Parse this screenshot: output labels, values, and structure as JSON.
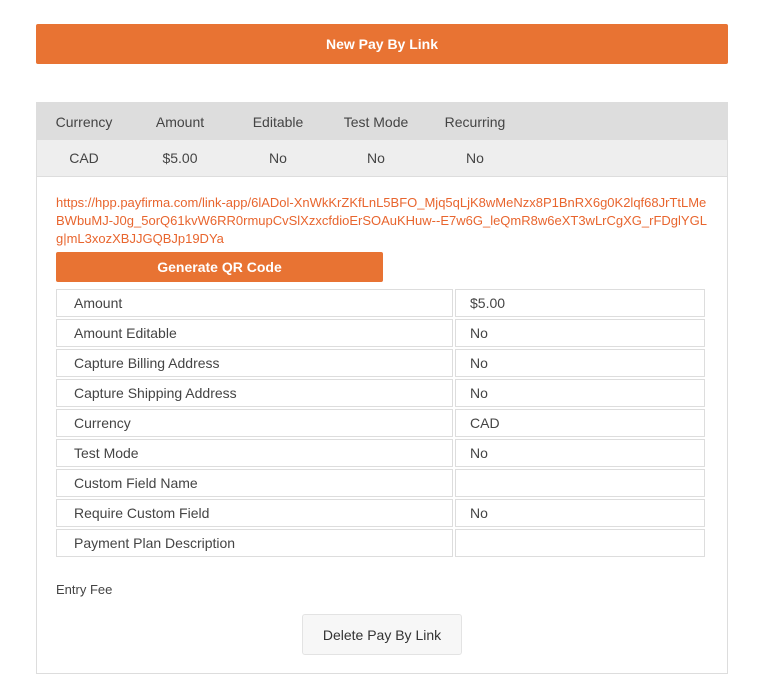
{
  "header": {
    "new_button_label": "New Pay By Link"
  },
  "colors": {
    "accent": "#e87333",
    "link": "#e8652e",
    "header_bg": "#dddddd",
    "row_bg": "#eeeeee"
  },
  "summary": {
    "columns": [
      "Currency",
      "Amount",
      "Editable",
      "Test Mode",
      "Recurring"
    ],
    "row": [
      "CAD",
      "$5.00",
      "No",
      "No",
      "No"
    ]
  },
  "link": {
    "url": "https://hpp.payfirma.com/link-app/6lADol-XnWkKrZKfLnL5BFO_Mjq5qLjK8wMeNzx8P1BnRX6g0K2lqf68JrTtLMeBWbuMJ-J0g_5orQ61kvW6RR0rmupCvSlXzxcfdioErSOAuKHuw--E7w6G_leQmR8w6eXT3wLrCgXG_rFDglYGLg|mL3xozXBJJGQBJp19DYa",
    "qr_button_label": "Generate QR Code"
  },
  "details": [
    {
      "label": "Amount",
      "value": "$5.00"
    },
    {
      "label": "Amount Editable",
      "value": "No"
    },
    {
      "label": "Capture Billing Address",
      "value": "No"
    },
    {
      "label": "Capture Shipping Address",
      "value": "No"
    },
    {
      "label": "Currency",
      "value": "CAD"
    },
    {
      "label": "Test Mode",
      "value": "No"
    },
    {
      "label": "Custom Field Name",
      "value": ""
    },
    {
      "label": "Require Custom Field",
      "value": "No"
    },
    {
      "label": "Payment Plan Description",
      "value": ""
    }
  ],
  "description": "Entry Fee",
  "delete_button_label": "Delete Pay By Link"
}
